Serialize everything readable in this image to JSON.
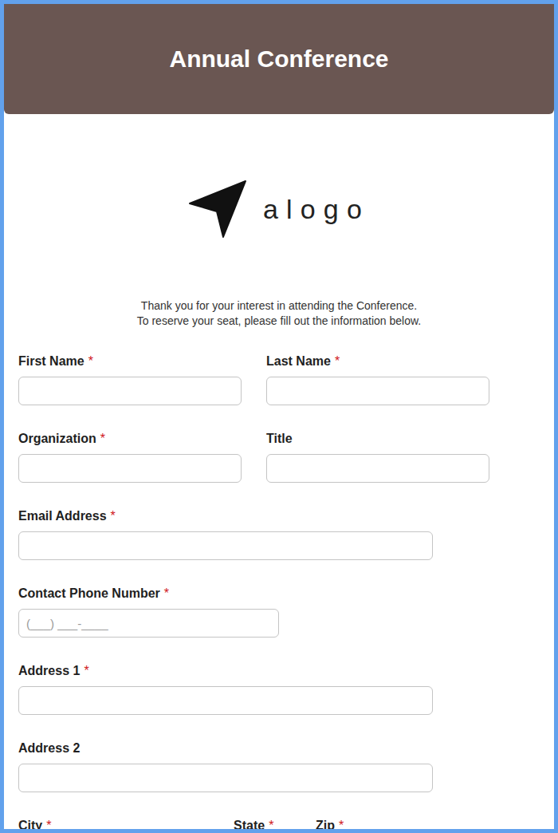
{
  "header": {
    "title": "Annual Conference"
  },
  "logo": {
    "text": "alogo"
  },
  "intro": [
    "Thank you for your interest in attending the Conference.",
    "To reserve your seat, please fill out the information below."
  ],
  "form": {
    "required_mark": "*",
    "rows": [
      {
        "kind": "pair",
        "fields": [
          {
            "label": "First Name",
            "required": true,
            "placeholder": ""
          },
          {
            "label": "Last Name",
            "required": true,
            "placeholder": ""
          }
        ]
      },
      {
        "kind": "pair",
        "fields": [
          {
            "label": "Organization",
            "required": true,
            "placeholder": ""
          },
          {
            "label": "Title",
            "required": false,
            "placeholder": ""
          }
        ]
      },
      {
        "kind": "full",
        "fields": [
          {
            "label": "Email Address",
            "required": true,
            "placeholder": ""
          }
        ]
      },
      {
        "kind": "phone",
        "fields": [
          {
            "label": "Contact Phone Number",
            "required": true,
            "placeholder": "(___) ___-____"
          }
        ]
      },
      {
        "kind": "full",
        "fields": [
          {
            "label": "Address 1",
            "required": true,
            "placeholder": ""
          }
        ]
      },
      {
        "kind": "full",
        "fields": [
          {
            "label": "Address 2",
            "required": false,
            "placeholder": ""
          }
        ]
      },
      {
        "kind": "triple",
        "fields": [
          {
            "label": "City",
            "required": true,
            "placeholder": ""
          },
          {
            "label": "State",
            "required": true,
            "placeholder": ""
          },
          {
            "label": "Zip",
            "required": true,
            "placeholder": ""
          }
        ]
      }
    ]
  }
}
